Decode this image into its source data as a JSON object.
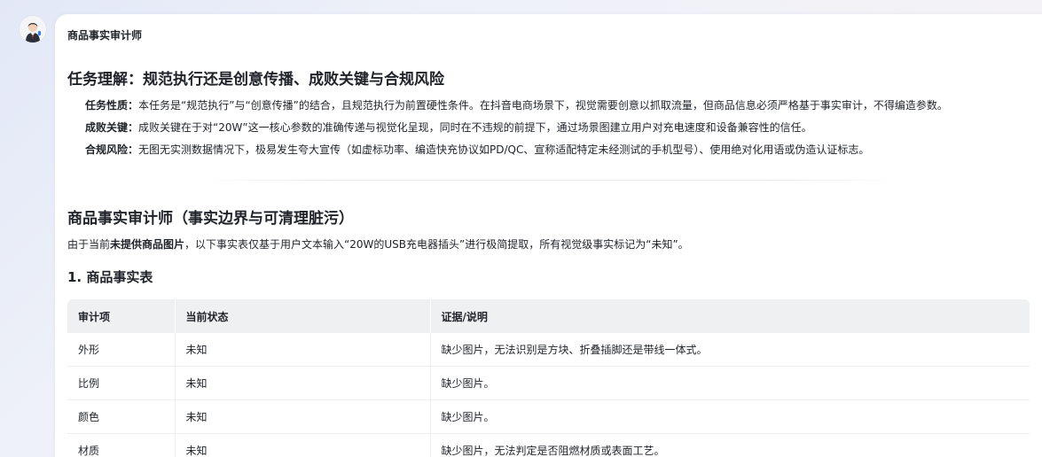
{
  "agent": {
    "name": "商品事实审计师"
  },
  "section1": {
    "title": "任务理解：规范执行还是创意传播、成败关键与合规风险",
    "items": [
      {
        "label": "任务性质：",
        "text": "本任务是“规范执行”与“创意传播”的结合，且规范执行为前置硬性条件。在抖音电商场景下，视觉需要创意以抓取流量，但商品信息必须严格基于事实审计，不得编造参数。"
      },
      {
        "label": "成败关键：",
        "text": "成败关键在于对“20W”这一核心参数的准确传递与视觉化呈现，同时在不违规的前提下，通过场景图建立用户对充电速度和设备兼容性的信任。"
      },
      {
        "label": "合规风险：",
        "text": "无图无实测数据情况下，极易发生夸大宣传（如虚标功率、编造快充协议如PD/QC、宣称适配特定未经测试的手机型号）、使用绝对化用语或伪造认证标志。"
      }
    ]
  },
  "section2": {
    "title": "商品事实审计师（事实边界与可清理脏污）",
    "intro_prefix": "由于当前",
    "intro_bold": "未提供商品图片",
    "intro_suffix": "，以下事实表仅基于用户文本输入“20W的USB充电器插头”进行极简提取，所有视觉级事实标记为“未知”。",
    "subtitle": "1. 商品事实表",
    "table": {
      "headers": [
        "审计项",
        "当前状态",
        "证据/说明"
      ],
      "rows": [
        [
          "外形",
          "未知",
          "缺少图片，无法识别是方块、折叠插脚还是带线一体式。"
        ],
        [
          "比例",
          "未知",
          "缺少图片。"
        ],
        [
          "颜色",
          "未知",
          "缺少图片。"
        ],
        [
          "材质",
          "未知",
          "缺少图片，无法判定是否阻燃材质或表面工艺。"
        ]
      ]
    }
  }
}
